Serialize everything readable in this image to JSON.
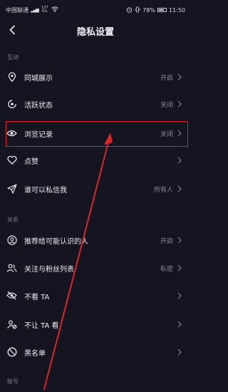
{
  "status_bar": {
    "carrier": "中国联通",
    "signal_icon": "signal-bars-icon",
    "speed_value": "127",
    "speed_unit": "K/s",
    "wifi_icon": "wifi-icon",
    "battery_percent_text": "78%",
    "battery_level": 0.78,
    "time": "11:50"
  },
  "header": {
    "back_icon": "chevron-left-icon",
    "title": "隐私设置"
  },
  "sections": [
    {
      "label": "互动",
      "items": [
        {
          "icon": "location-pin-icon",
          "label": "同城展示",
          "value": "开启"
        },
        {
          "icon": "activity-status-icon",
          "label": "活跃状态",
          "value": "关闭"
        },
        {
          "icon": "eye-icon",
          "label": "浏览记录",
          "value": "关闭"
        },
        {
          "icon": "heart-icon",
          "label": "点赞",
          "value": ""
        },
        {
          "icon": "send-paper-plane-icon",
          "label": "谁可以私信我",
          "value": "所有人"
        }
      ]
    },
    {
      "label": "关系",
      "items": [
        {
          "icon": "person-circle-icon",
          "label": "推荐给可能认识的人",
          "value": "开启"
        },
        {
          "icon": "followers-icon",
          "label": "关注与粉丝列表",
          "value": "私密"
        },
        {
          "icon": "eye-off-icon",
          "label": "不看 TA",
          "value": ""
        },
        {
          "icon": "user-blocked-icon",
          "label": "不让 TA 看",
          "value": ""
        },
        {
          "icon": "block-icon",
          "label": "黑名单",
          "value": ""
        }
      ]
    },
    {
      "label": "账号",
      "items": []
    }
  ],
  "annotation": {
    "highlight_color": "#d8262a",
    "arrow_color": "#d8262a"
  }
}
